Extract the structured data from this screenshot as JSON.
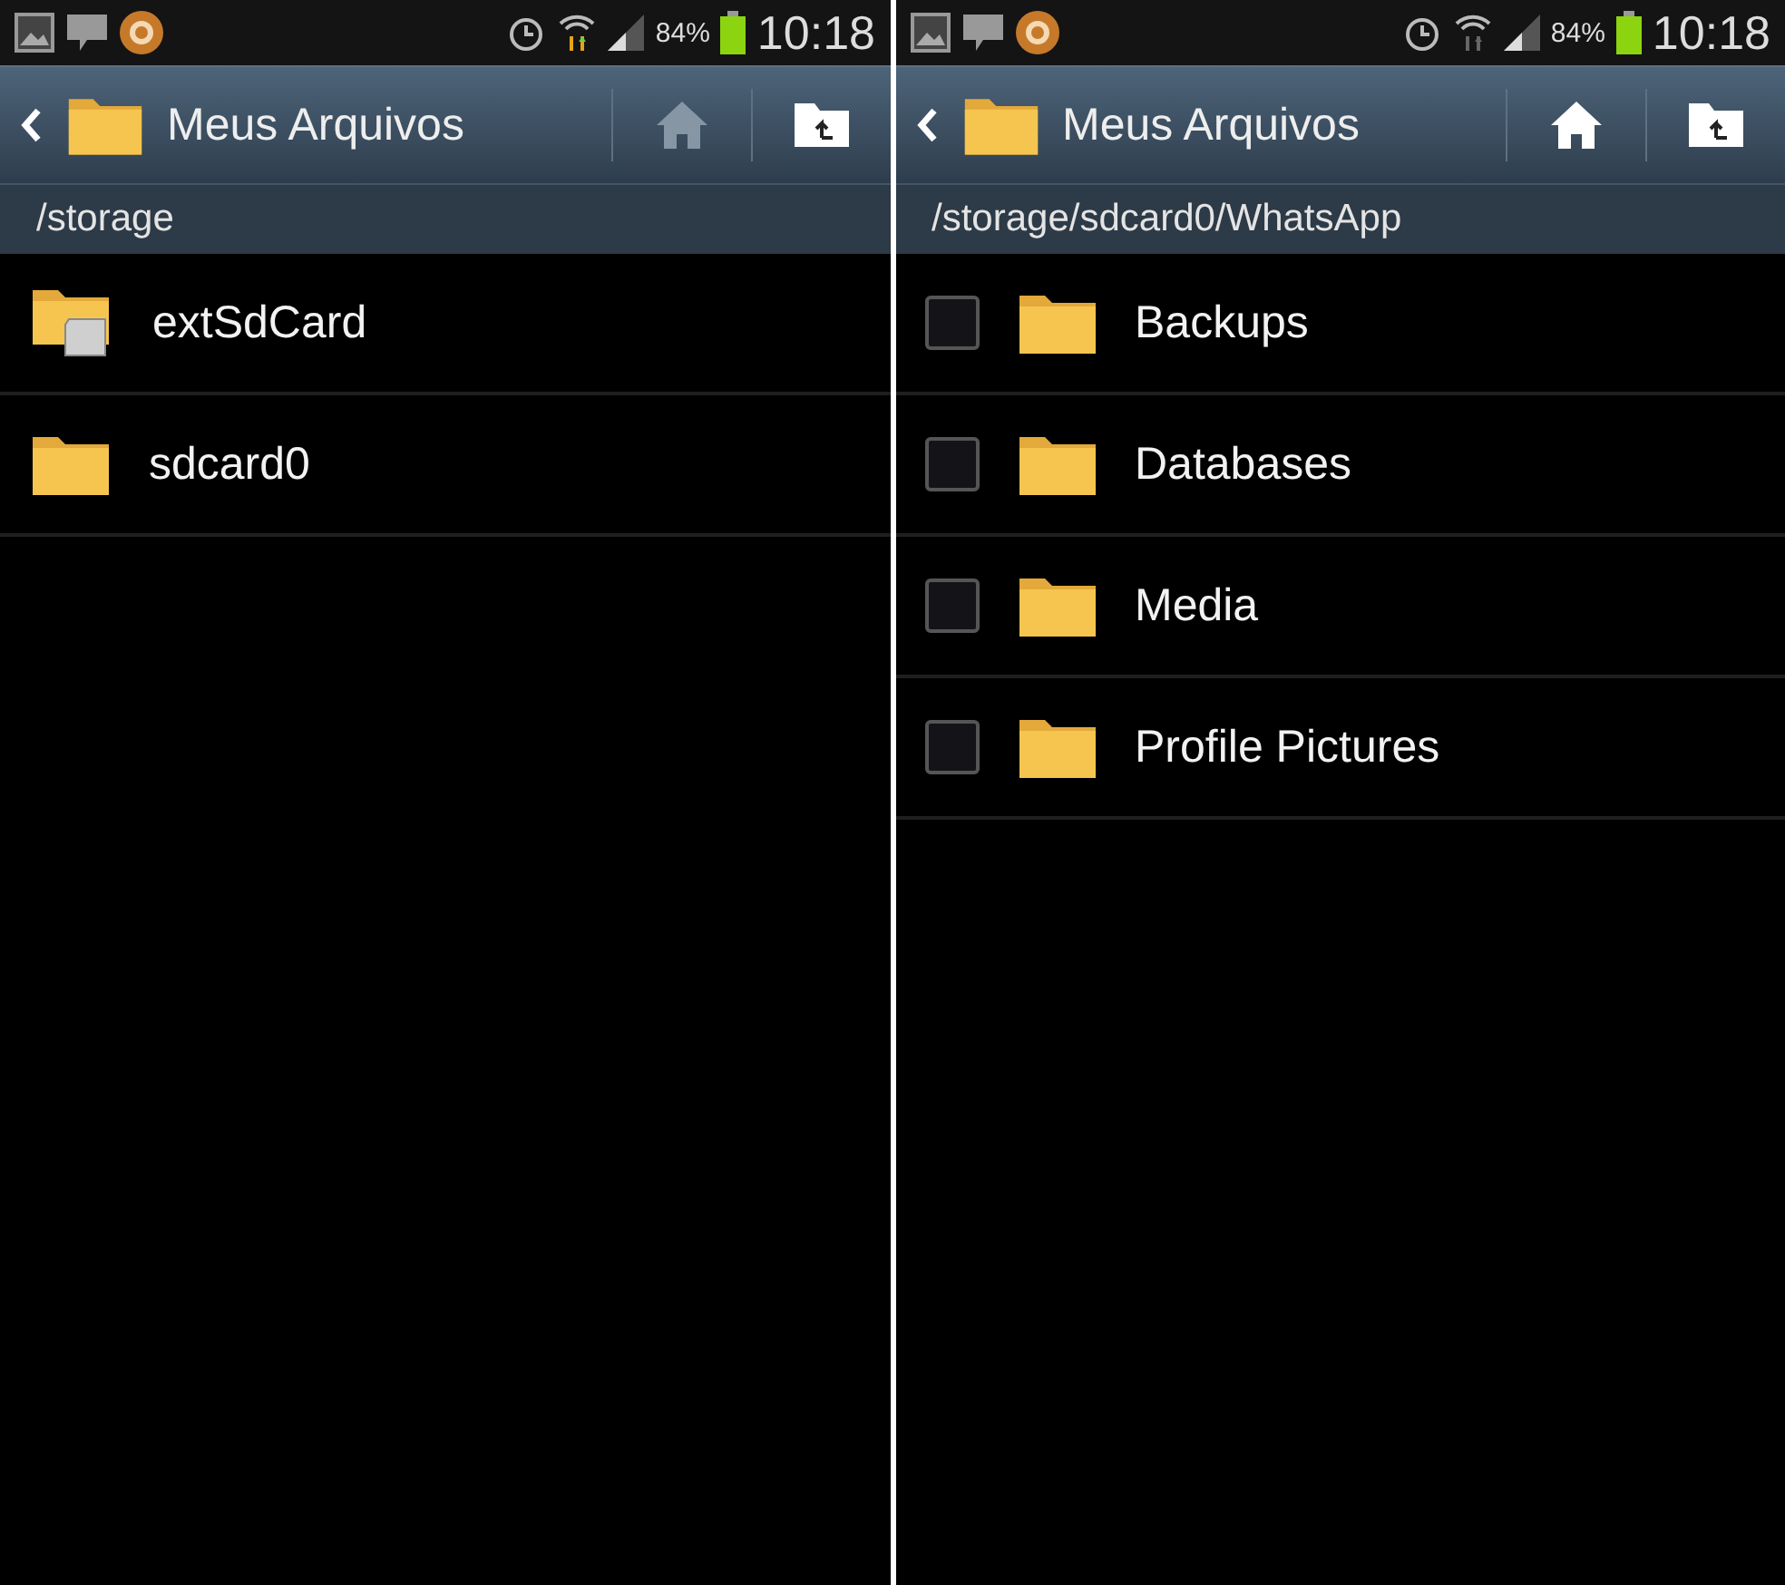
{
  "screens": [
    {
      "status_bar": {
        "battery": "84%",
        "time": "10:18",
        "data_active": true
      },
      "title": "Meus Arquivos",
      "home_disabled": true,
      "path": "/storage",
      "items": [
        {
          "name": "extSdCard",
          "kind": "sdcard"
        },
        {
          "name": "sdcard0",
          "kind": "folder"
        }
      ]
    },
    {
      "status_bar": {
        "battery": "84%",
        "time": "10:18",
        "data_active": false
      },
      "title": "Meus Arquivos",
      "home_disabled": false,
      "path": "/storage/sdcard0/WhatsApp",
      "items": [
        {
          "name": "Backups",
          "kind": "folder",
          "checked": false
        },
        {
          "name": "Databases",
          "kind": "folder",
          "checked": false
        },
        {
          "name": "Media",
          "kind": "folder",
          "checked": false
        },
        {
          "name": "Profile Pictures",
          "kind": "folder",
          "checked": false
        }
      ]
    }
  ]
}
